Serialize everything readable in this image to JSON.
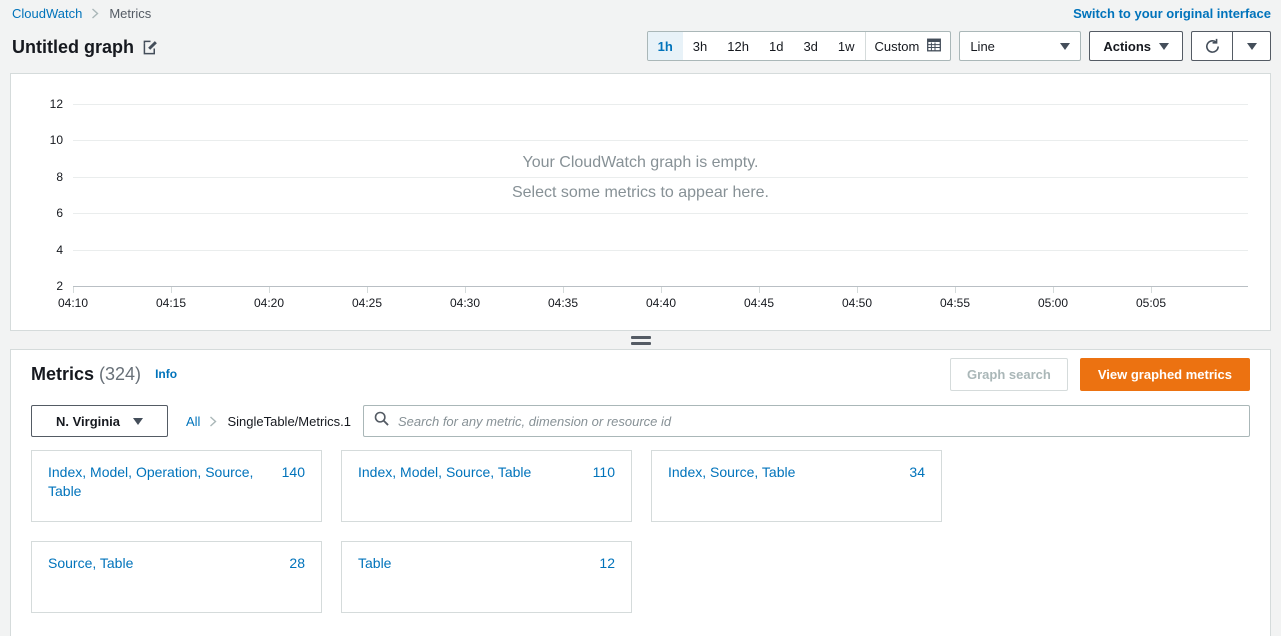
{
  "topbar": {
    "breadcrumb": {
      "root": "CloudWatch",
      "current": "Metrics",
      "separator_icon": "chevron-right-icon"
    },
    "switch_link": "Switch to your original interface"
  },
  "title_row": {
    "graph_title": "Untitled graph",
    "edit_icon": "edit-pencil-icon"
  },
  "toolbar": {
    "ranges": [
      {
        "label": "1h",
        "active": true
      },
      {
        "label": "3h",
        "active": false
      },
      {
        "label": "12h",
        "active": false
      },
      {
        "label": "1d",
        "active": false
      },
      {
        "label": "3d",
        "active": false
      },
      {
        "label": "1w",
        "active": false
      }
    ],
    "custom_label": "Custom",
    "custom_icon": "calendar-icon",
    "chart_type": "Line",
    "actions_label": "Actions",
    "refresh_icon": "refresh-icon",
    "caret_icon": "chevron-down-icon"
  },
  "graph": {
    "empty_line1": "Your CloudWatch graph is empty.",
    "empty_line2": "Select some metrics to appear here."
  },
  "chart_data": {
    "type": "line",
    "title": "Untitled graph",
    "series": [],
    "x": [],
    "xlabel": "",
    "ylabel": "",
    "xtick_labels": [
      "04:10",
      "04:15",
      "04:20",
      "04:25",
      "04:30",
      "04:35",
      "04:40",
      "04:45",
      "04:50",
      "04:55",
      "05:00",
      "05:05"
    ],
    "ytick_labels": [
      "12",
      "10",
      "8",
      "6",
      "4",
      "2"
    ],
    "ylim": [
      2,
      12
    ],
    "grid": true,
    "legend": "none",
    "empty": true
  },
  "resize": {
    "handle_icon": "drag-handle-icon"
  },
  "metrics": {
    "title": "Metrics",
    "count": "(324)",
    "info_label": "Info",
    "graph_search_label": "Graph search",
    "view_graphed_label": "View graphed metrics",
    "region": "N. Virginia",
    "filter_root": "All",
    "filter_current": "SingleTable/Metrics.1",
    "search_placeholder": "Search for any metric, dimension or resource id",
    "search_value": "",
    "search_icon": "search-icon",
    "cards": [
      {
        "label": "Index, Model, Operation, Source, Table",
        "count": "140"
      },
      {
        "label": "Index, Model, Source, Table",
        "count": "110"
      },
      {
        "label": "Index, Source, Table",
        "count": "34"
      },
      {
        "label": "Source, Table",
        "count": "28"
      },
      {
        "label": "Table",
        "count": "12"
      }
    ]
  },
  "colors": {
    "link": "#0073bb",
    "primary": "#ec7211",
    "page_bg": "#f2f3f3",
    "muted": "#879196"
  }
}
